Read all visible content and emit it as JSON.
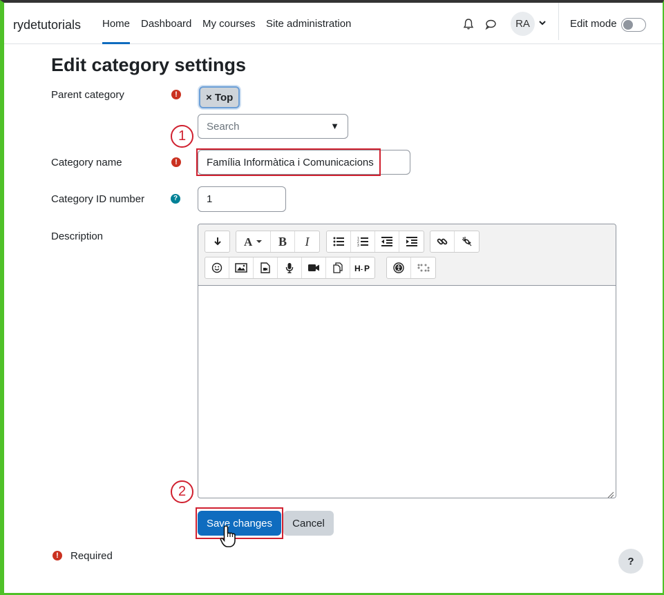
{
  "navbar": {
    "brand": "rydetutorials",
    "items": [
      {
        "label": "Home",
        "active": true
      },
      {
        "label": "Dashboard"
      },
      {
        "label": "My courses"
      },
      {
        "label": "Site administration"
      }
    ],
    "avatar_initials": "RA",
    "edit_mode_label": "Edit mode",
    "edit_mode_on": false
  },
  "page": {
    "title": "Edit category settings"
  },
  "form": {
    "parent_category_label": "Parent category",
    "parent_tag": "× Top",
    "parent_search_placeholder": "Search",
    "category_name_label": "Category name",
    "category_name_value": "Família Informàtica i Comunicacions",
    "category_id_label": "Category ID number",
    "category_id_value": "1",
    "description_label": "Description",
    "save_label": "Save changes",
    "cancel_label": "Cancel",
    "required_text": "Required"
  },
  "annotations": {
    "step1": "1",
    "step2": "2"
  },
  "colors": {
    "primary": "#0f6cbf",
    "danger": "#ca3120",
    "annotation_red": "#d0202f",
    "help": "#008196"
  },
  "help_button_label": "?"
}
